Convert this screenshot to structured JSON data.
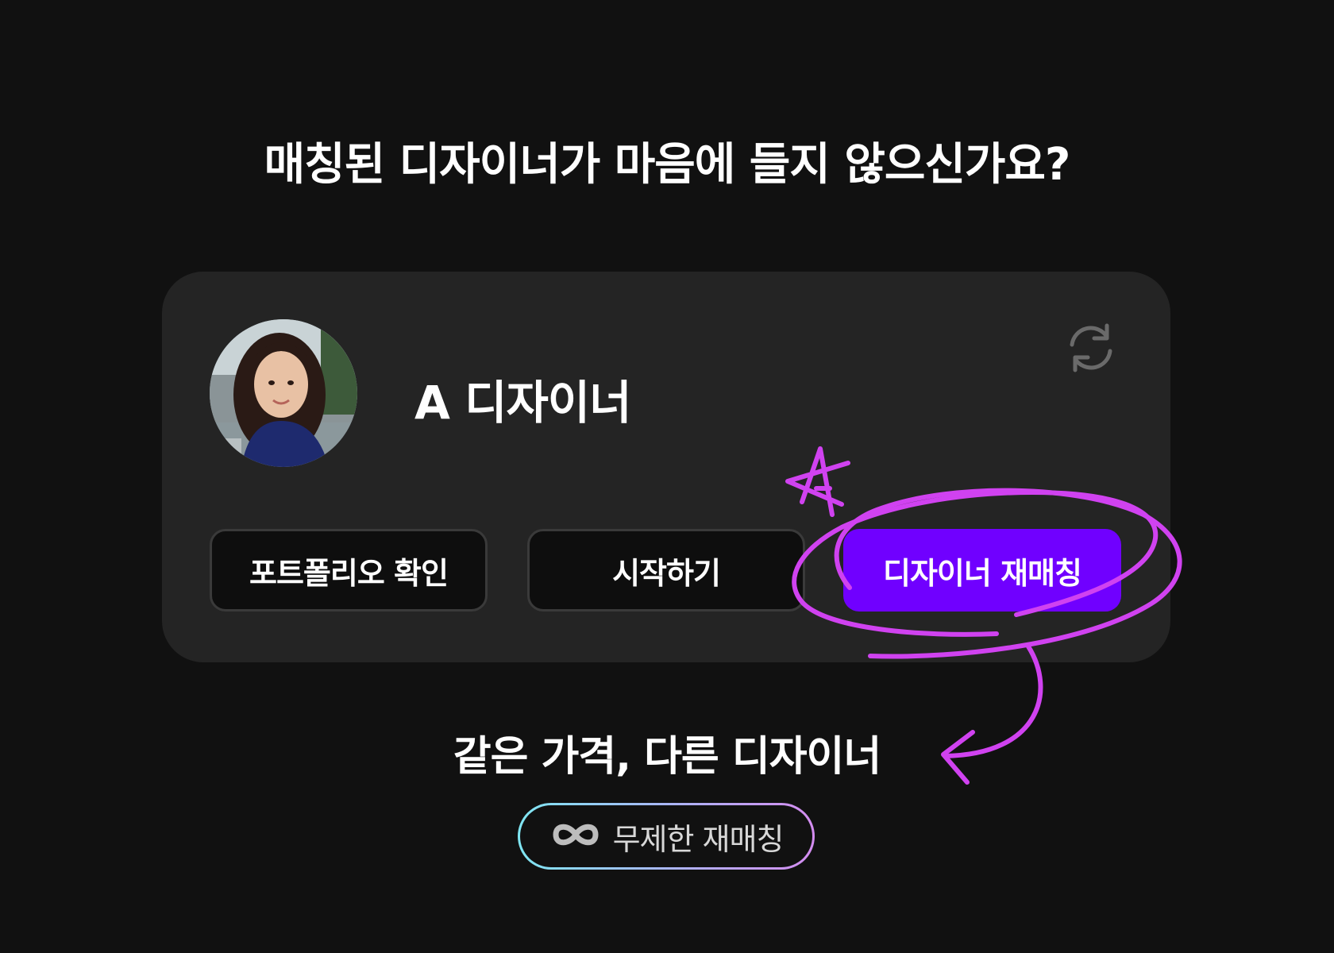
{
  "headline": "매칭된 디자이너가 마음에 들지 않으신가요?",
  "card": {
    "designer_name": "A 디자이너",
    "buttons": {
      "portfolio": "포트폴리오 확인",
      "start": "시작하기",
      "rematch": "디자이너 재매칭"
    }
  },
  "subline": "같은 가격, 다른 디자이너",
  "badge": {
    "label": "무제한 재매칭",
    "icon": "infinity-icon"
  },
  "colors": {
    "background": "#111111",
    "card": "#242424",
    "accent": "#7000ff",
    "doodle": "#d042f0"
  }
}
